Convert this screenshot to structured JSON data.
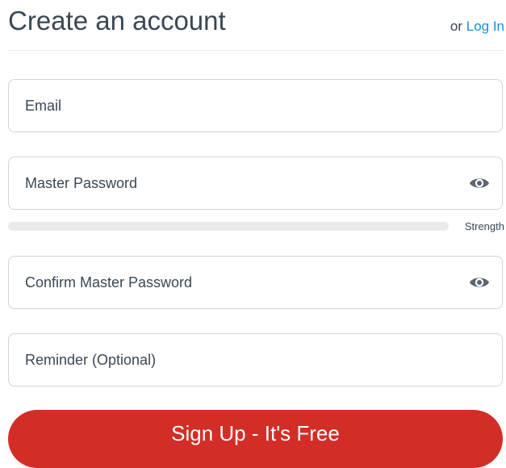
{
  "header": {
    "title": "Create an account",
    "or_text": "or ",
    "login_link": "Log In"
  },
  "form": {
    "email": {
      "placeholder": "Email",
      "value": ""
    },
    "master_password": {
      "placeholder": "Master Password",
      "value": "",
      "toggle_icon": "eye-icon"
    },
    "strength": {
      "label": "Strength",
      "level": 0
    },
    "confirm_password": {
      "placeholder": "Confirm Master Password",
      "value": "",
      "toggle_icon": "eye-icon"
    },
    "reminder": {
      "placeholder": "Reminder (Optional)",
      "value": ""
    },
    "submit_label": "Sign Up - It's Free"
  },
  "colors": {
    "accent": "#d32d27",
    "link": "#1a8fd8",
    "text": "#3b4754",
    "border": "#cfd4d9",
    "track": "#e8ebee"
  }
}
